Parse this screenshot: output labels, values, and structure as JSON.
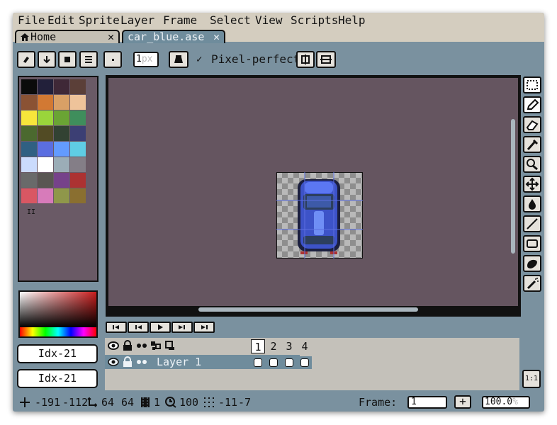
{
  "menu": [
    "File",
    "Edit",
    "Sprite",
    "Layer",
    "Frame",
    "Select",
    "View",
    "Scripts",
    "Help"
  ],
  "tabs": {
    "home": {
      "label": "Home",
      "close": "✕"
    },
    "document": {
      "label": "car_blue.ase",
      "close": "✕"
    }
  },
  "toolbar": {
    "brush_size_value": "1",
    "brush_size_unit": "px",
    "pixel_perfect_check": "✓",
    "pixel_perfect_label": "Pixel-perfect"
  },
  "palette": {
    "colors": [
      "#0b0b0b",
      "#22203a",
      "#3f2837",
      "#5b3f38",
      "#8a5234",
      "#d27933",
      "#d9a066",
      "#eec39a",
      "#f7e63b",
      "#9ad53b",
      "#6aa434",
      "#3f8e5c",
      "#4b692f",
      "#524b24",
      "#324233",
      "#3c3f74",
      "#306082",
      "#5b6ee1",
      "#639bff",
      "#5fcde4",
      "#cbdbfc",
      "#ffffff",
      "#9badb7",
      "#847e87",
      "#696a6a",
      "#595652",
      "#76428a",
      "#ac3232",
      "#d95763",
      "#d77bba",
      "#8f974a",
      "#8a6f30"
    ],
    "handle": "II"
  },
  "colors": {
    "foreground_index": "Idx-21",
    "background_index": "Idx-21"
  },
  "timeline": {
    "layer_name": "Layer 1",
    "frames": [
      "1",
      "2",
      "3",
      "4"
    ],
    "active_frame": "1"
  },
  "zoom_button": "1:1",
  "status": {
    "cursor_x": "-191",
    "cursor_y": "-112",
    "sprite_w": "64",
    "sprite_h": "64",
    "frame_count": "1",
    "duration": "100",
    "grid_x": "-11",
    "grid_y": "-7",
    "frame_label": "Frame:",
    "frame_value": "1",
    "add_frame": "+",
    "zoom_value": "100.0",
    "zoom_unit": "%"
  }
}
